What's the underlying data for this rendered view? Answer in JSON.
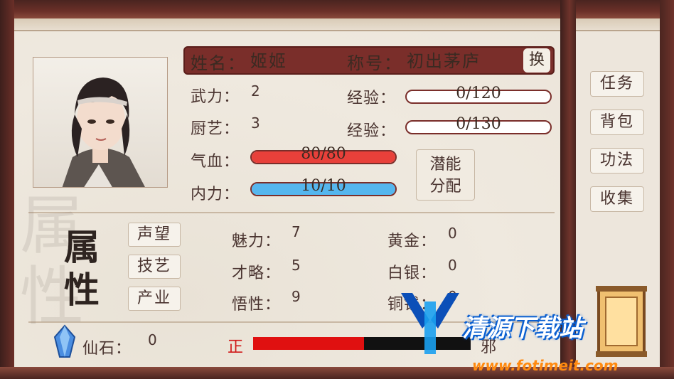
{
  "profile": {
    "name_label": "姓名：",
    "name_value": "姬姬",
    "title_label": "称号：",
    "title_value": "初出茅庐",
    "swap_label": "换"
  },
  "skills": {
    "martial": {
      "label": "武力：",
      "value": "2",
      "exp_label": "经验：",
      "exp_text": "0/120",
      "exp_progress": 0
    },
    "cooking": {
      "label": "厨艺：",
      "value": "3",
      "exp_label": "经验：",
      "exp_text": "0/130",
      "exp_progress": 0
    }
  },
  "vitals": {
    "hp": {
      "label": "气血：",
      "text": "80/80",
      "progress": 1.0,
      "color": "#e8403a"
    },
    "mp": {
      "label": "内力：",
      "text": "10/10",
      "progress": 1.0,
      "color": "#55b6ee"
    }
  },
  "potential_button": {
    "line1": "潜能",
    "line2": "分配"
  },
  "side_menu": [
    {
      "label": "任务"
    },
    {
      "label": "背包"
    },
    {
      "label": "功法"
    },
    {
      "label": "收集"
    }
  ],
  "attributes_title": [
    "属",
    "性"
  ],
  "attribute_tabs": [
    {
      "label": "声望"
    },
    {
      "label": "技艺"
    },
    {
      "label": "产业"
    }
  ],
  "stats": {
    "charm": {
      "label": "魅力：",
      "value": "7"
    },
    "talent": {
      "label": "才略：",
      "value": "5"
    },
    "insight": {
      "label": "悟性：",
      "value": "9"
    },
    "gold": {
      "label": "黄金：",
      "value": "0"
    },
    "silver": {
      "label": "白银：",
      "value": "0"
    },
    "copper": {
      "label": "铜钱：",
      "value": "0"
    }
  },
  "spirit_stone": {
    "label": "仙石：",
    "value": "0"
  },
  "alignment": {
    "good_label": "正",
    "evil_label": "邪",
    "good_fraction": 0.51,
    "good_color": "#e01010"
  },
  "watermark": {
    "text": "清源下载站",
    "url": "www.fotimeit.com"
  }
}
